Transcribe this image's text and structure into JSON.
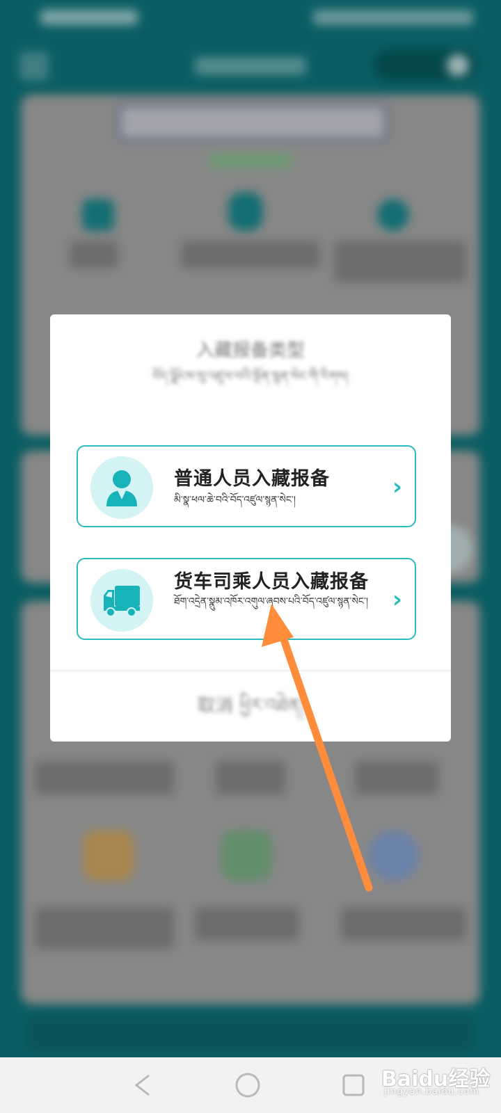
{
  "dialog": {
    "title": "入藏报备类型",
    "subtitle": "བོད་ལྗོངས་སུ་འཛུལ་བའི་སྔོན་སྙན་སེང་གི་རིགས།",
    "options": [
      {
        "title": "普通人员入藏报备",
        "subtitle": "མི་སྣ་ཕལ་ཆེ་བའི་བོད་འཛུལ་སྙན་སེང་།",
        "icon": "person-icon"
      },
      {
        "title": "货车司乘人员入藏报备",
        "subtitle": "ཐོག་འདྲེན་སྣུམ་འཁོར་འགུལ་ཞབས་པའི་བོད་འཛུལ་སྙན་སེང་།",
        "icon": "truck-icon"
      }
    ],
    "cancel_label": "取消 ཕྱིར་འཐེན།"
  },
  "watermark": {
    "main": "Baidu经验",
    "sub": "jingyan.baidu.com"
  },
  "colors": {
    "accent": "#2cbcc0",
    "icon_bg": "#d3f3f4",
    "arrow": "#ff8c3a",
    "header": "#0b6b70"
  }
}
